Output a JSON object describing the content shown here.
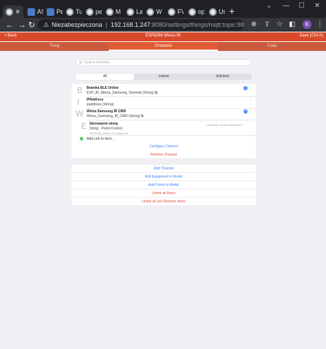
{
  "browser": {
    "tabs": [
      {
        "label": ""
      },
      {
        "label": "AS"
      },
      {
        "label": "Pe"
      },
      {
        "label": "Tu"
      },
      {
        "label": "pe"
      },
      {
        "label": "M"
      },
      {
        "label": "La"
      },
      {
        "label": "W"
      },
      {
        "label": "FV"
      },
      {
        "label": "op"
      },
      {
        "label": "Us"
      }
    ],
    "address": {
      "security": "Niezabezpieczona",
      "host": "192.168.1.247",
      "path": ":8080/settings/things/mqtt:topic:88624..."
    },
    "avatar_letter": "K"
  },
  "app": {
    "back_label": "Back",
    "title": "ESP8266 Wieża IR",
    "save_label": "Save (Ctrl-S)",
    "tabs": [
      "Thing",
      "Channels",
      "Code"
    ]
  },
  "channels": {
    "search_placeholder": "Search channels",
    "filters": [
      "All",
      "Linked",
      "Unlinked"
    ],
    "items": [
      {
        "letter": "B",
        "title": "Bramka BLE Online",
        "sub": "ESP_IR_Wieza_Samsung_Tasmota (String)",
        "badge": "1"
      },
      {
        "letter": "I",
        "title": "IPAddress",
        "sub": "ipaddress (String)"
      },
      {
        "letter": "W",
        "title": "Wieża Samsung IR CMD",
        "sub": "Wieza_Samsung_IR_CMD (String)",
        "badge": "1"
      },
      {
        "letter": "E",
        "title": "Sterowanie wieżą",
        "sub": "String · Point>Control",
        "sub2": "ESP8266_Wieza_IR_polecenie",
        "state": "{\"IRSend\":\"Invalid RawData\"}"
      }
    ],
    "add_link_label": "Add Link to Item...",
    "configure_label": "Configure Channel",
    "remove_label": "Remove Channel"
  },
  "actions": [
    {
      "label": "Add Channel",
      "color": "blue"
    },
    {
      "label": "Add Equipment to Model",
      "color": "blue"
    },
    {
      "label": "Add Points to Model",
      "color": "blue"
    },
    {
      "label": "Unlink all Items",
      "color": "red"
    },
    {
      "label": "Unlink all and Remove Items",
      "color": "red"
    }
  ],
  "colors": {
    "accent": "#d84a2a",
    "link": "#3b82f6",
    "danger": "#e04a3a"
  }
}
